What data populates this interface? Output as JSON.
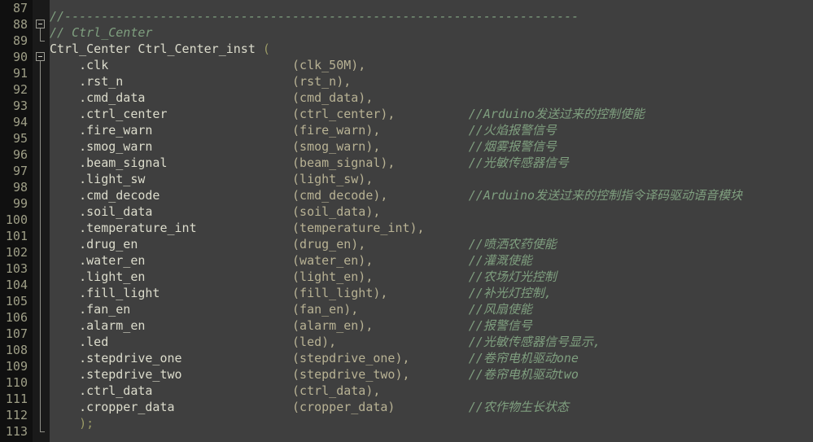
{
  "editor": {
    "theme_name": "zenburn",
    "background": "#3f3f3f",
    "linenum_background": "#101010",
    "fold_background": "#1a1a1a",
    "linenum_color": "#9f9f87",
    "text_color": "#dcdccc",
    "signal_color": "#b8b294",
    "punct_color": "#9a9a66",
    "comment_color": "#7f9f7f",
    "first_line": 87,
    "last_line": 113,
    "language": "Verilog"
  },
  "line_numbers": [
    "87",
    "88",
    "89",
    "90",
    "91",
    "92",
    "93",
    "94",
    "95",
    "96",
    "97",
    "98",
    "99",
    "100",
    "101",
    "102",
    "103",
    "104",
    "105",
    "106",
    "107",
    "108",
    "109",
    "110",
    "111",
    "112",
    "113"
  ],
  "separator_comment": "//----------------------------------------------------------------------",
  "lines": [
    {
      "number": "87",
      "kind": "blank",
      "fold": "none",
      "segments": []
    },
    {
      "number": "88",
      "kind": "comment",
      "fold": "box",
      "segments": [
        {
          "cls": "tok-comment",
          "text": "//----------------------------------------------------------------------"
        }
      ]
    },
    {
      "number": "89",
      "kind": "comment",
      "fold": "corner",
      "segments": [
        {
          "cls": "tok-comment",
          "text": "// Ctrl_Center"
        }
      ]
    },
    {
      "number": "90",
      "kind": "instance-header",
      "fold": "box",
      "segments": [
        {
          "cls": "tok-plain",
          "text": "Ctrl_Center Ctrl_Center_inst "
        },
        {
          "cls": "tok-punct",
          "text": "("
        }
      ]
    },
    {
      "number": "91",
      "kind": "port",
      "fold": "line",
      "port": ".clk",
      "signal": "(clk_50M),",
      "comment": ""
    },
    {
      "number": "92",
      "kind": "port",
      "fold": "line",
      "port": ".rst_n",
      "signal": "(rst_n),",
      "comment": ""
    },
    {
      "number": "93",
      "kind": "port",
      "fold": "line",
      "port": ".cmd_data",
      "signal": "(cmd_data),",
      "comment": ""
    },
    {
      "number": "94",
      "kind": "port",
      "fold": "line",
      "port": ".ctrl_center",
      "signal": "(ctrl_center),",
      "comment": "//Arduino发送过来的控制使能"
    },
    {
      "number": "95",
      "kind": "port",
      "fold": "line",
      "port": ".fire_warn",
      "signal": "(fire_warn),",
      "comment": "//火焰报警信号"
    },
    {
      "number": "96",
      "kind": "port",
      "fold": "line",
      "port": ".smog_warn",
      "signal": "(smog_warn),",
      "comment": "//烟雾报警信号"
    },
    {
      "number": "97",
      "kind": "port",
      "fold": "line",
      "port": ".beam_signal",
      "signal": "(beam_signal),",
      "comment": "//光敏传感器信号"
    },
    {
      "number": "98",
      "kind": "port",
      "fold": "line",
      "port": ".light_sw",
      "signal": "(light_sw),",
      "comment": ""
    },
    {
      "number": "99",
      "kind": "port",
      "fold": "line",
      "port": ".cmd_decode",
      "signal": "(cmd_decode),",
      "comment": "//Arduino发送过来的控制指令译码驱动语音模块"
    },
    {
      "number": "100",
      "kind": "port",
      "fold": "line",
      "port": ".soil_data",
      "signal": "(soil_data),",
      "comment": ""
    },
    {
      "number": "101",
      "kind": "port",
      "fold": "line",
      "port": ".temperature_int",
      "signal": "(temperature_int),",
      "comment": ""
    },
    {
      "number": "102",
      "kind": "port",
      "fold": "line",
      "port": ".drug_en",
      "signal": "(drug_en),",
      "comment": "//喷洒农药使能"
    },
    {
      "number": "103",
      "kind": "port",
      "fold": "line",
      "port": ".water_en",
      "signal": "(water_en),",
      "comment": "//灌溉使能"
    },
    {
      "number": "104",
      "kind": "port",
      "fold": "line",
      "port": ".light_en",
      "signal": "(light_en),",
      "comment": "//农场灯光控制"
    },
    {
      "number": "105",
      "kind": "port",
      "fold": "line",
      "port": ".fill_light",
      "signal": "(fill_light),",
      "comment": "//补光灯控制,"
    },
    {
      "number": "106",
      "kind": "port",
      "fold": "line",
      "port": ".fan_en",
      "signal": "(fan_en),",
      "comment": "//风扇使能"
    },
    {
      "number": "107",
      "kind": "port",
      "fold": "line",
      "port": ".alarm_en",
      "signal": "(alarm_en),",
      "comment": "//报警信号"
    },
    {
      "number": "108",
      "kind": "port",
      "fold": "line",
      "port": ".led",
      "signal": "(led),",
      "comment": "//光敏传感器信号显示,"
    },
    {
      "number": "109",
      "kind": "port",
      "fold": "line",
      "port": ".stepdrive_one",
      "signal": "(stepdrive_one),",
      "comment": "//卷帘电机驱动one"
    },
    {
      "number": "110",
      "kind": "port",
      "fold": "line",
      "port": ".stepdrive_two",
      "signal": "(stepdrive_two),",
      "comment": "//卷帘电机驱动two"
    },
    {
      "number": "111",
      "kind": "port",
      "fold": "line",
      "port": ".ctrl_data",
      "signal": "(ctrl_data),",
      "comment": ""
    },
    {
      "number": "112",
      "kind": "port",
      "fold": "line",
      "port": ".cropper_data",
      "signal": "(cropper_data)",
      "comment": "//农作物生长状态"
    },
    {
      "number": "113",
      "kind": "close",
      "fold": "corner",
      "segments": [
        {
          "cls": "tok-punct",
          "text": "    );"
        }
      ]
    }
  ]
}
